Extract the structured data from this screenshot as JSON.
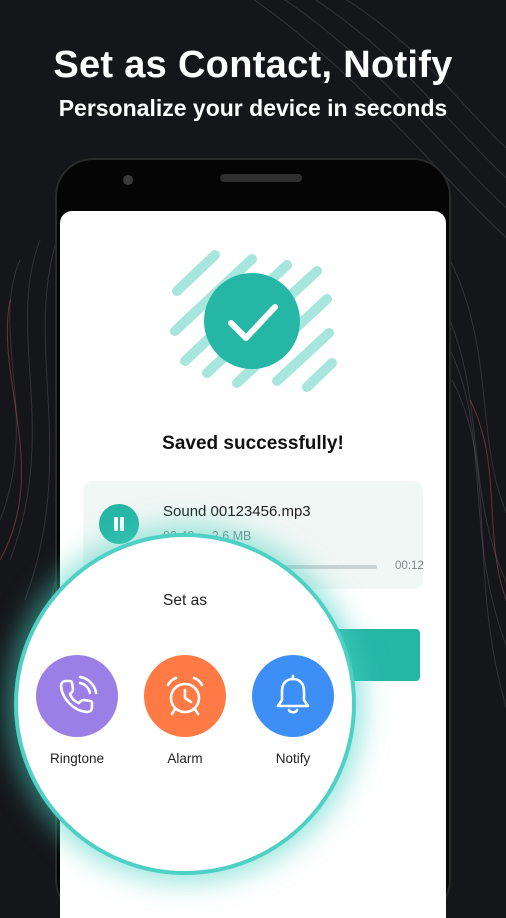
{
  "headline": "Set as Contact, Notify",
  "subline": "Personalize your device in seconds",
  "saved_title": "Saved successfully!",
  "audio": {
    "file_name": "Sound 00123456.mp3",
    "current_time": "02:43",
    "file_size": "2.6 MB",
    "total_time": "00:12",
    "progress_fraction": 0.5
  },
  "set_as": {
    "title": "Set as",
    "options": [
      {
        "label": "Ringtone",
        "icon": "phone-ringing-icon",
        "color": "#9b7fe6"
      },
      {
        "label": "Alarm",
        "icon": "alarm-clock-icon",
        "color": "#ff7a45"
      },
      {
        "label": "Notify",
        "icon": "bell-icon",
        "color": "#3d8ef5"
      }
    ]
  },
  "colors": {
    "accent": "#26b6a6",
    "background": "#15161a",
    "glow": "#4fd0c4"
  }
}
